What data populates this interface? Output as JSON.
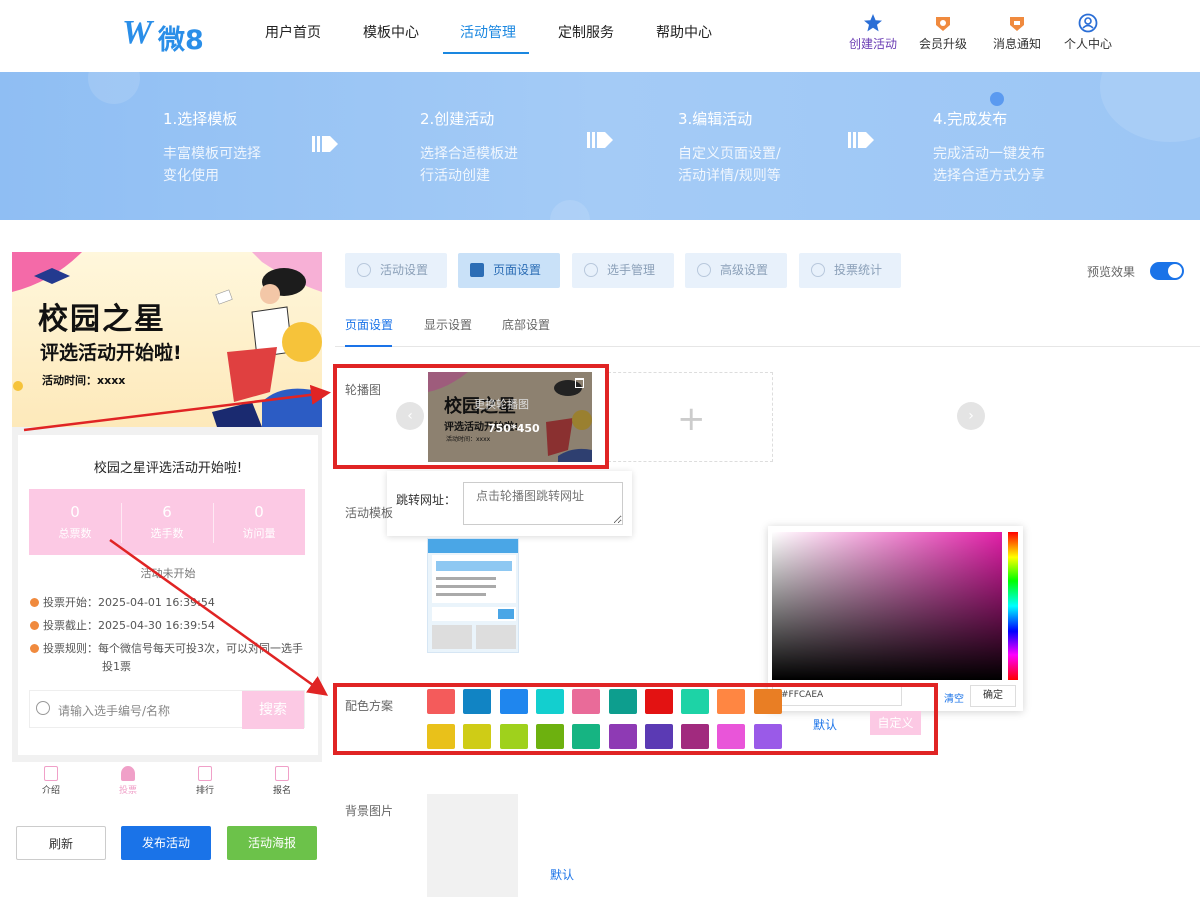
{
  "nav": {
    "logo_w": "W",
    "logo_text": "微8",
    "items": [
      "用户首页",
      "模板中心",
      "活动管理",
      "定制服务",
      "帮助中心"
    ],
    "active_index": 2,
    "icons": [
      {
        "label": "创建活动",
        "icon": "star-icon"
      },
      {
        "label": "会员升级",
        "icon": "crown-icon"
      },
      {
        "label": "消息通知",
        "icon": "bell-icon"
      },
      {
        "label": "个人中心",
        "icon": "user-icon"
      }
    ]
  },
  "banner": {
    "steps": [
      {
        "title": "1.选择模板",
        "desc1": "丰富模板可选择",
        "desc2": "变化使用"
      },
      {
        "title": "2.创建活动",
        "desc1": "选择合适模板进",
        "desc2": "行活动创建"
      },
      {
        "title": "3.编辑活动",
        "desc1": "自定义页面设置/",
        "desc2": "活动详情/规则等"
      },
      {
        "title": "4.完成发布",
        "desc1": "完成活动一键发布",
        "desc2": "选择合适方式分享"
      }
    ]
  },
  "preview": {
    "poster_title": "校园之星",
    "poster_sub": "评选活动开始啦!",
    "poster_time": "活动时间：xxxx",
    "card_title": "校园之星评选活动开始啦!",
    "stats": [
      {
        "value": "0",
        "label": "总票数"
      },
      {
        "value": "6",
        "label": "选手数"
      },
      {
        "value": "0",
        "label": "访问量"
      }
    ],
    "status": "活动未开始",
    "vote_start": "投票开始：2025-04-01 16:39:54",
    "vote_end": "投票截止：2025-04-30 16:39:54",
    "vote_rule_1": "投票规则：每个微信号每天可投3次，可以对同一选手",
    "vote_rule_2": "投1票",
    "search_placeholder": "请输入选手编号/名称",
    "search_btn": "搜索",
    "tabs": [
      "介绍",
      "投票",
      "排行",
      "报名"
    ],
    "active_tab": 1
  },
  "buttons": {
    "refresh": "刷新",
    "publish": "发布活动",
    "poster": "活动海报"
  },
  "colors": {
    "publish": "#1a73e8",
    "poster": "#6cc24a",
    "accent": "#1a87e0",
    "pink": "#fcc9e4"
  },
  "settings": {
    "top_tabs": [
      "活动设置",
      "页面设置",
      "选手管理",
      "高级设置",
      "投票统计"
    ],
    "active_top_tab": 1,
    "preview_label": "预览效果",
    "preview_on": true,
    "sub_tabs": [
      "页面设置",
      "显示设置",
      "底部设置"
    ],
    "carousel_label": "轮播图",
    "carousel_overlay": "更换轮播图",
    "carousel_size": "750*450",
    "thumb_title": "校园之星",
    "thumb_sub": "评选活动开始啦!",
    "thumb_time": "活动时间：xxxx",
    "url_label": "跳转网址：",
    "url_placeholder": "点击轮播图跳转网址",
    "template_label": "活动模板",
    "color_label": "配色方案",
    "hex_value": "#FFCAEA",
    "clear": "清空",
    "ok": "确定",
    "default": "默认",
    "custom": "自定义",
    "bg_label": "背景图片",
    "bg_default": "默认",
    "swatches_row1": [
      "#f45b5b",
      "#1184c4",
      "#1f86ee",
      "#13cfcf",
      "#e96b99",
      "#0d9e8e",
      "#e31212",
      "#1dd3a6",
      "#ff8642",
      "#e97e24"
    ],
    "swatches_row2": [
      "#e9c11a",
      "#cfcc16",
      "#9fd11c",
      "#6db10f",
      "#16b482",
      "#8e3ab4",
      "#5b3ab4",
      "#a12a7e",
      "#e955d9",
      "#9a5ae8"
    ]
  }
}
